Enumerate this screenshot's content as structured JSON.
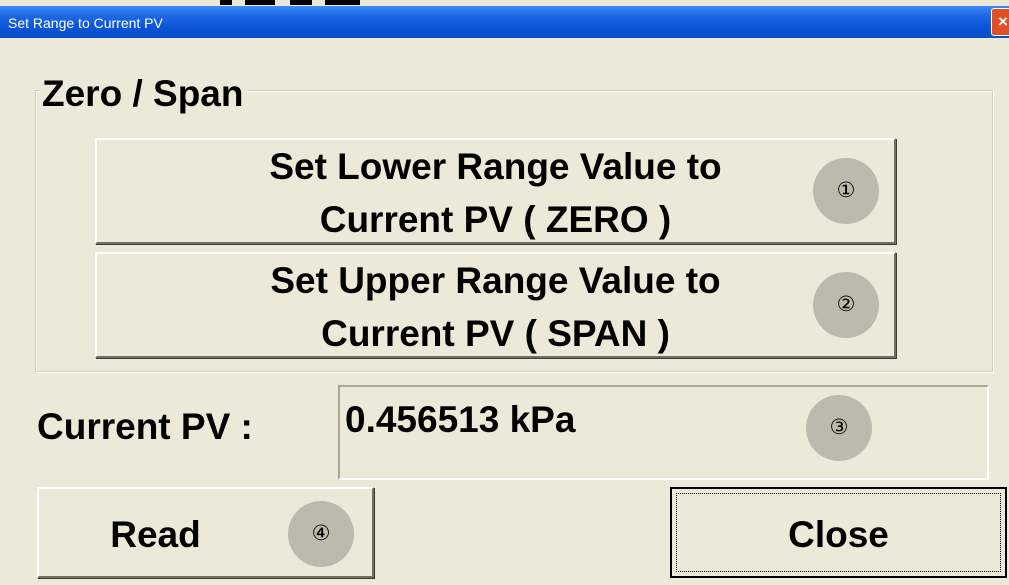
{
  "window": {
    "title": "Set Range to Current PV",
    "close_glyph": "×"
  },
  "group": {
    "legend": "Zero / Span"
  },
  "buttons": {
    "lower_line1": "Set Lower Range Value to",
    "lower_line2": "Current PV ( ZERO )",
    "upper_line1": "Set Upper Range Value to",
    "upper_line2": "Current PV ( SPAN )",
    "read": "Read",
    "close": "Close"
  },
  "pv": {
    "label": "Current PV :",
    "value": "0.456513 kPa"
  },
  "markers": {
    "m1": "①",
    "m2": "②",
    "m3": "③",
    "m4": "④"
  },
  "colors": {
    "dialog_bg": "#ece9d8",
    "titlebar": "#0a54d6",
    "close_button": "#e24e26",
    "marker_circle": "#bcb9ad"
  }
}
